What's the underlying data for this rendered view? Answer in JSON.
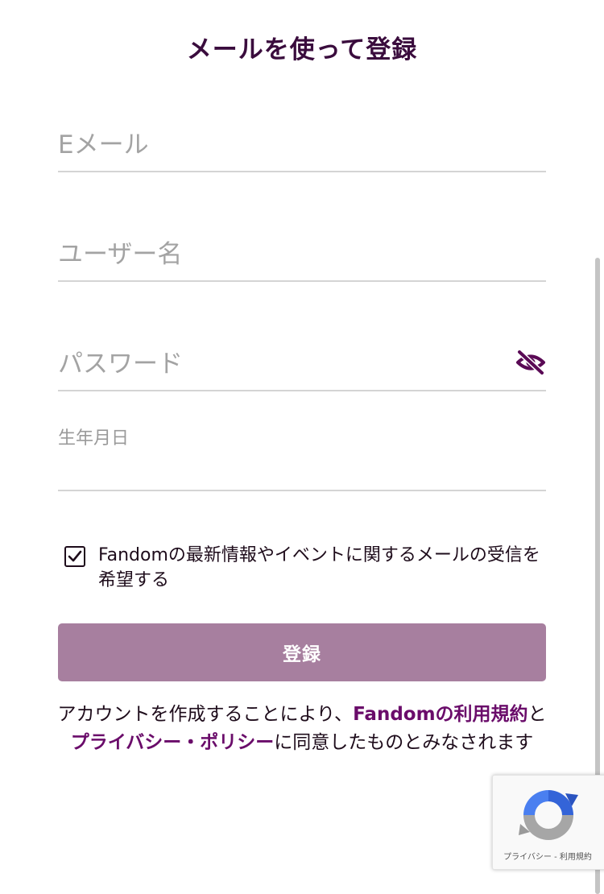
{
  "header": {
    "title": "メールを使って登録"
  },
  "form": {
    "email_placeholder": "Eメール",
    "username_placeholder": "ユーザー名",
    "password_placeholder": "パスワード",
    "birthdate_label": "生年月日",
    "marketing_consent": {
      "checked": true,
      "label": "Fandomの最新情報やイベントに関するメールの受信を希望する"
    },
    "submit_label": "登録"
  },
  "legal": {
    "prefix": "アカウントを作成することにより、",
    "terms_link": "Fandomの利用規約",
    "conjunction": "と",
    "privacy_link": "プライバシー・ポリシー",
    "suffix": "に同意したものとみなされます"
  },
  "recaptcha": {
    "privacy": "プライバシー",
    "separator": " - ",
    "terms": "利用規約"
  },
  "colors": {
    "title": "#3a0c3d",
    "link": "#6a0c6a",
    "button_bg": "#a77f9f",
    "icon": "#5a0a55"
  },
  "icons": {
    "password_toggle": "eye-slash-icon",
    "checkbox": "checkmark-icon",
    "recaptcha": "recaptcha-logo-icon"
  }
}
